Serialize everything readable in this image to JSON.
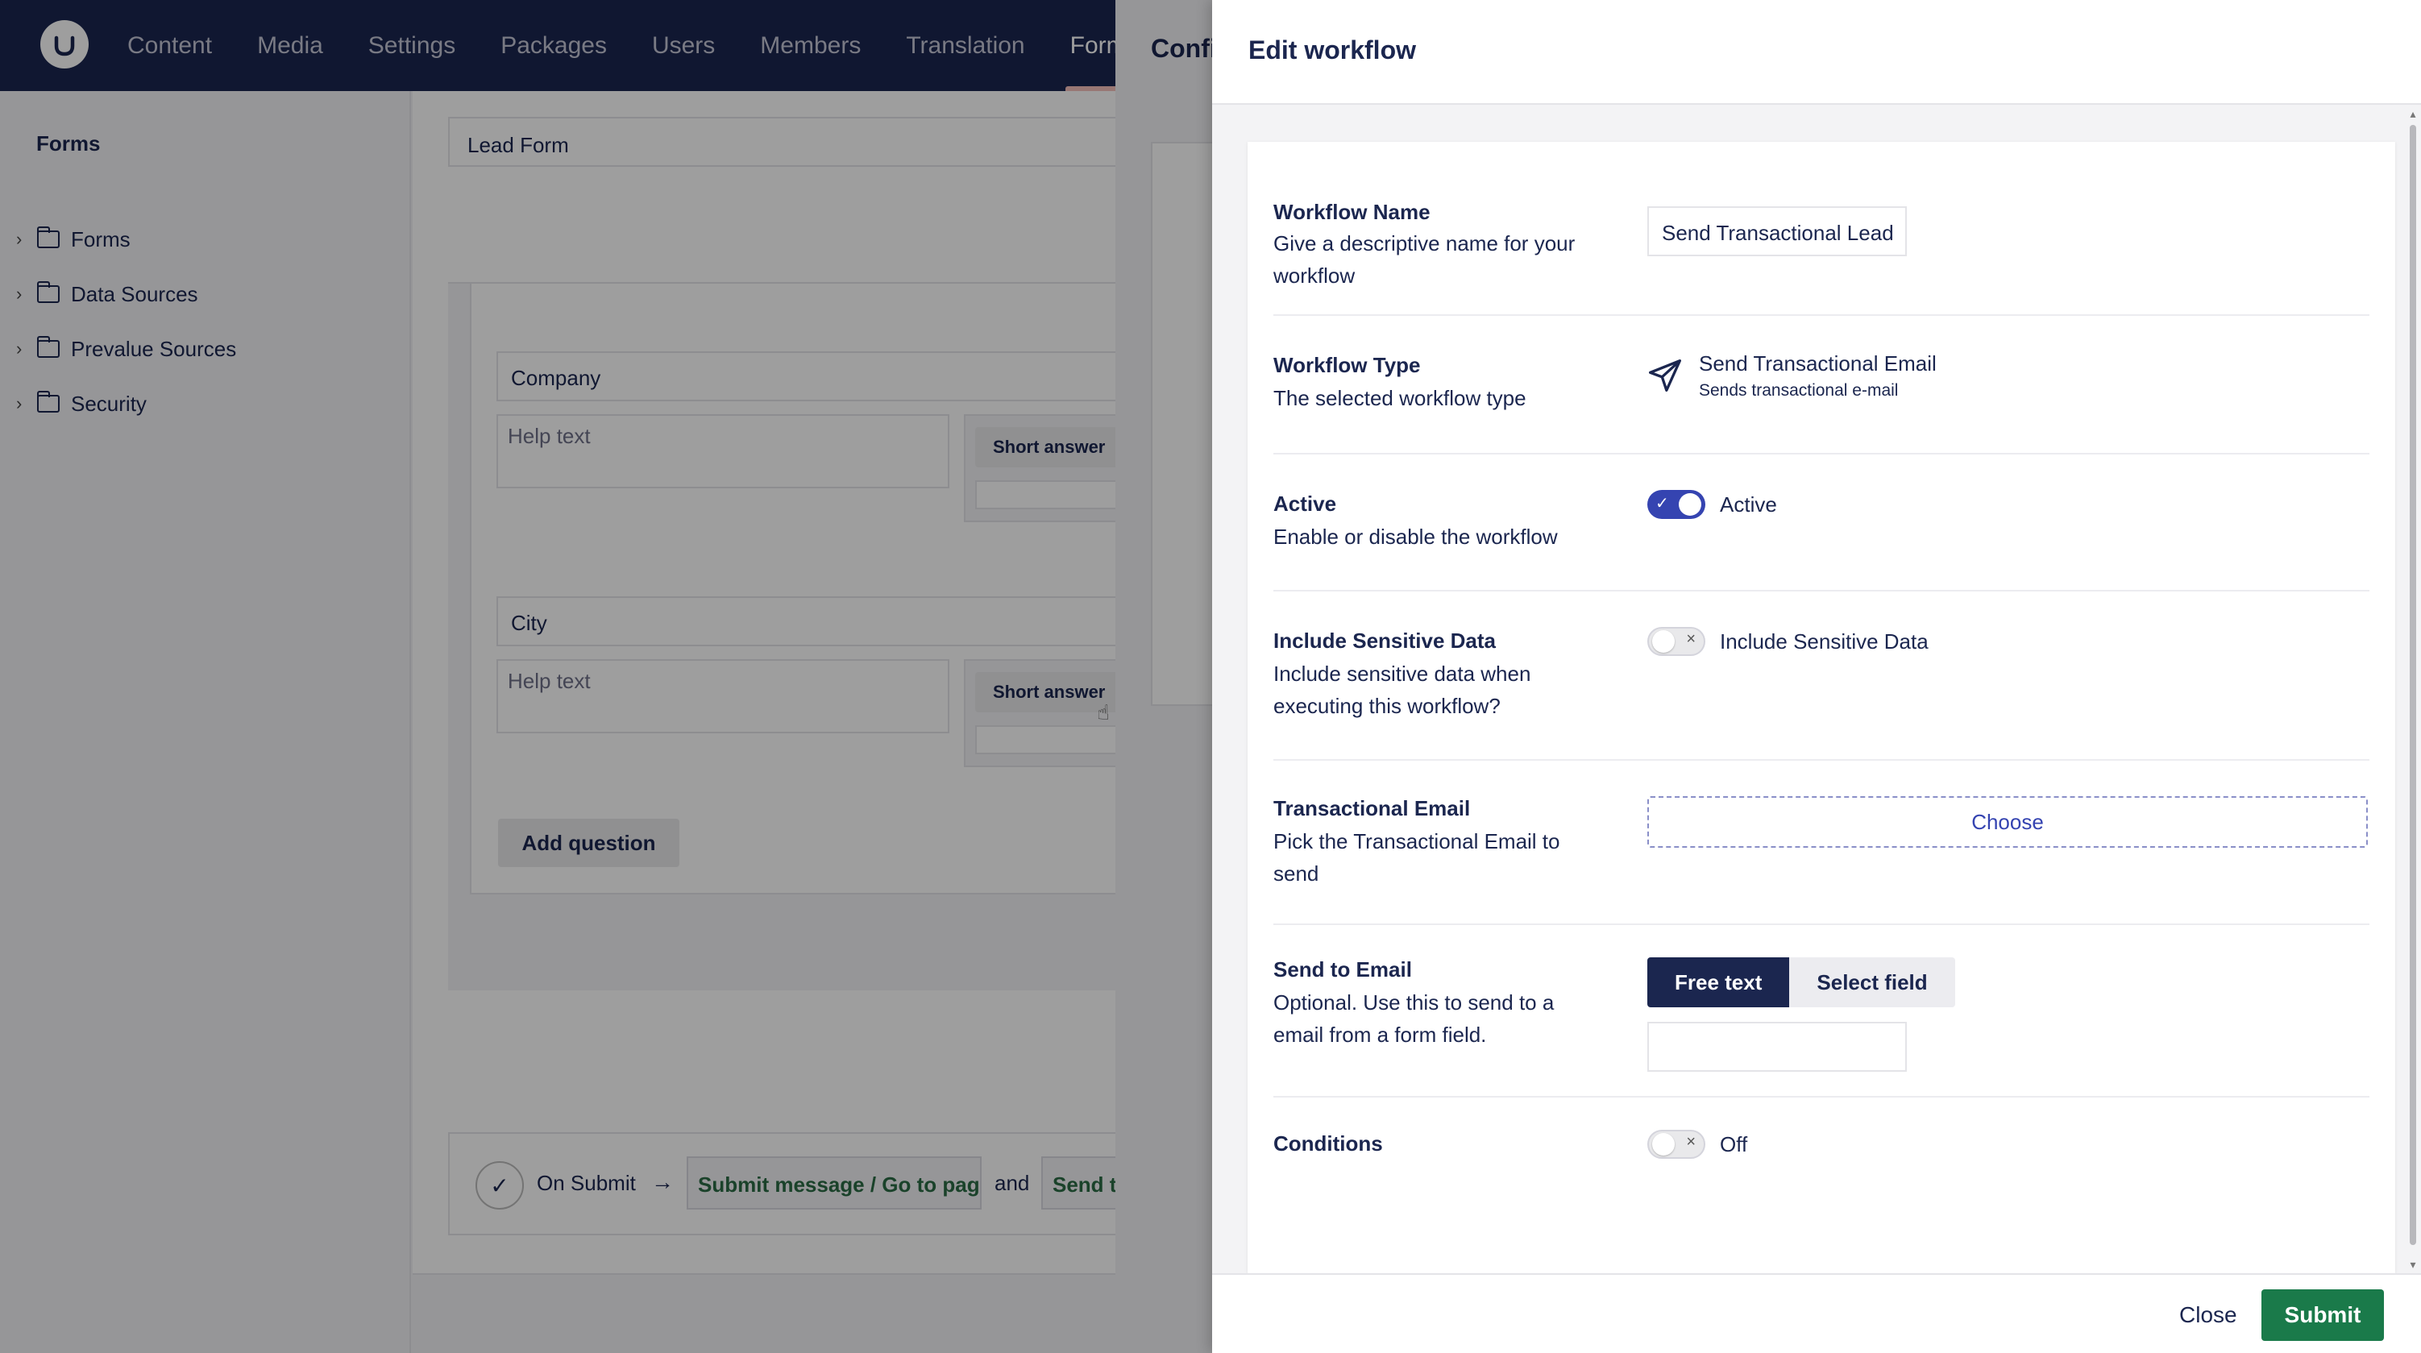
{
  "header": {
    "nav": [
      "Content",
      "Media",
      "Settings",
      "Packages",
      "Users",
      "Members",
      "Translation",
      "Forms"
    ],
    "active": "Forms"
  },
  "sidebar": {
    "title": "Forms",
    "items": [
      {
        "label": "Forms"
      },
      {
        "label": "Data Sources"
      },
      {
        "label": "Prevalue Sources"
      },
      {
        "label": "Security"
      }
    ]
  },
  "editor": {
    "form_name": "Lead Form",
    "questions": [
      {
        "caption": "Company",
        "help_placeholder": "Help text",
        "type": "Short answer"
      },
      {
        "caption": "City",
        "help_placeholder": "Help text",
        "type": "Short answer"
      }
    ],
    "add_question": "Add question",
    "submit_bar": {
      "on_submit": "On Submit",
      "message_chip": "Submit message / Go to page",
      "and": "and",
      "workflow_chip": "Send te"
    }
  },
  "mid_panel": {
    "title": "Confi"
  },
  "panel": {
    "title": "Edit workflow",
    "rows": {
      "name": {
        "label": "Workflow Name",
        "desc": "Give a descriptive name for your workflow",
        "value": "Send Transactional Lead"
      },
      "type": {
        "label": "Workflow Type",
        "desc": "The selected workflow type",
        "type_name": "Send Transactional Email",
        "type_sub": "Sends transactional e-mail",
        "icon": "paper-plane-icon"
      },
      "active": {
        "label": "Active",
        "desc": "Enable or disable the workflow",
        "toggle_label": "Active",
        "on": true
      },
      "sensitive": {
        "label": "Include Sensitive Data",
        "desc": "Include sensitive data when executing this workflow?",
        "toggle_label": "Include Sensitive Data",
        "on": false
      },
      "email": {
        "label": "Transactional Email",
        "desc": "Pick the Transactional Email to send",
        "button": "Choose"
      },
      "send_to": {
        "label": "Send to Email",
        "desc": "Optional. Use this to send to a email from a form field.",
        "options": [
          "Free text",
          "Select field"
        ],
        "selected": "Free text",
        "value": ""
      },
      "conditions": {
        "label": "Conditions",
        "toggle_label": "Off",
        "on": false
      }
    },
    "footer": {
      "close": "Close",
      "submit": "Submit"
    }
  },
  "colors": {
    "header": "#1b264f",
    "accent": "#3544b1",
    "submit": "#1a7a4a"
  }
}
